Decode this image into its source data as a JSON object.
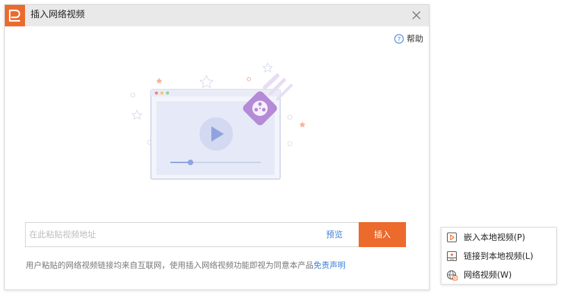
{
  "dialog": {
    "title": "插入网络视频",
    "help_label": "帮助",
    "url_input": {
      "placeholder": "在此粘贴视频地址",
      "value": ""
    },
    "preview_label": "预览",
    "insert_label": "插入",
    "notice_text": "用户粘贴的网络视频链接均来自互联网，使用插入网络视频功能即视为同意本产品",
    "disclaimer_label": "免责声明"
  },
  "video_menu": {
    "items": [
      {
        "label": "嵌入本地视频(P)",
        "icon": "embed-video-icon"
      },
      {
        "label": "链接到本地视频(L)",
        "icon": "link-video-icon"
      },
      {
        "label": "网络视频(W)",
        "icon": "web-video-icon"
      }
    ]
  },
  "colors": {
    "accent": "#eb6a2c",
    "link": "#3b7fd9",
    "illustration_purple": "#b58ad6",
    "illustration_blue": "#8fa3de"
  }
}
